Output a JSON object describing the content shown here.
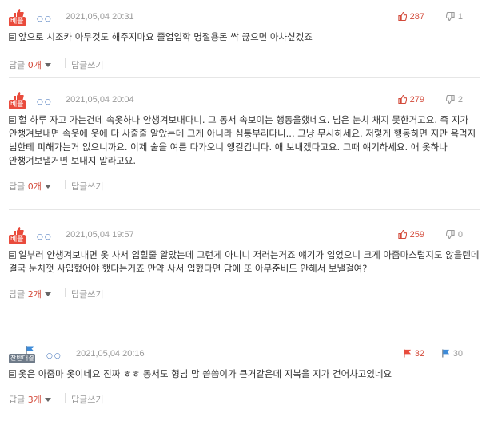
{
  "comments": [
    {
      "badge": "베플",
      "badge_type": "best",
      "dots": "○○",
      "date": "2021,05,04 20:31",
      "likes": "287",
      "dislikes": "1",
      "text": "앞으로 시조카 아무것도 해주지마요 졸업입학 명절용돈 싹 끊으면 아차싶겠죠",
      "reply_label": "답글",
      "reply_count": "0개",
      "write_reply": "답글쓰기"
    },
    {
      "badge": "베플",
      "badge_type": "best",
      "dots": "○○",
      "date": "2021,05,04 20:04",
      "likes": "279",
      "dislikes": "2",
      "text": "헐 하루 자고 가는건데 속옷하나 안챙겨보내다니. 그 동서 속보이는 행동을했네요. 님은 눈치 채지 못한거고요. 즉 지가 안챙겨보내면 속옷에 옷에 다 사줄줄 알았는데 그게 아니라 심통부리다니... 그냥 무시하세요. 저렇게 행동하면 지만 욕먹지 님한테 피해가는거 없으니까요. 이제 술을 여름 다가오니 앵길겁니다. 애 보내겠다고요. 그때 얘기하세요. 애 옷하나 안챙겨보낼거면 보내지 말라고요.",
      "reply_label": "답글",
      "reply_count": "0개",
      "write_reply": "답글쓰기"
    },
    {
      "badge": "베플",
      "badge_type": "best",
      "dots": "○○",
      "date": "2021,05,04 19:57",
      "likes": "259",
      "dislikes": "0",
      "text": "일부러 안챙겨보내면 옷 사서 입힐줄 알았는데 그런게 아니니 저러는거죠 얘기가 입었으니 크게 아줌마스럽지도 않을텐데 결국 눈치껏 사입혔어야 했다는거죠 만약 사서 입혔다면 담에 또 아무준비도 안해서 보낼걸여?",
      "reply_label": "답글",
      "reply_count": "2개",
      "write_reply": "답글쓰기"
    },
    {
      "badge": "찬반대결",
      "badge_type": "versus",
      "dots": "○○",
      "date": "2021,05,04 20:16",
      "likes": "32",
      "dislikes": "30",
      "text": "옷은 아줌마 옷이네요 진짜 ㅎㅎ 동서도 형님 맘 씀씀이가 큰거같은데 지복을 지가 걷어차고있네요",
      "reply_label": "답글",
      "reply_count": "3개",
      "write_reply": "답글쓰기"
    }
  ],
  "colors": {
    "accent_red": "#d34a3a",
    "badge_red": "#e94b3c",
    "badge_gray": "#6f7b89",
    "meta_gray": "#999999"
  },
  "icons": {
    "like": "thumbs-up-icon",
    "dislike": "thumbs-down-icon",
    "badge_best": "thumbs-up-icon",
    "badge_versus": "flag-icon",
    "comment": "document-icon",
    "expand": "caret-down-icon"
  }
}
